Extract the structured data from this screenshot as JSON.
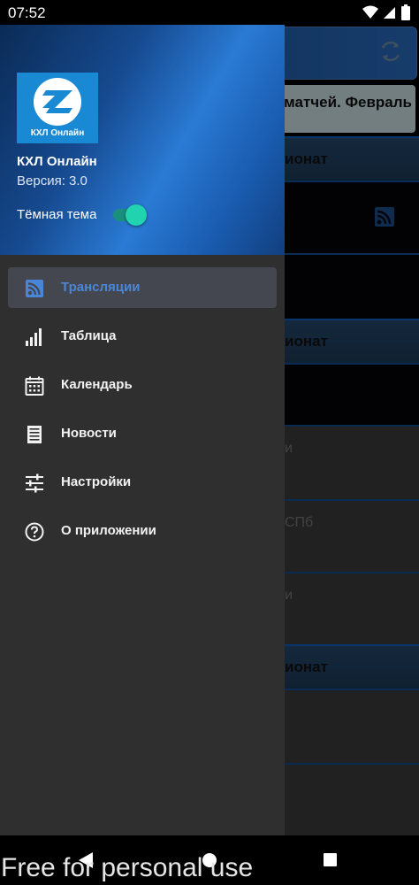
{
  "status_bar": {
    "time": "07:52"
  },
  "background": {
    "banner_text": "матчей. Февраль",
    "sections": [
      "ионат",
      "ионат",
      "ионат"
    ],
    "rows": [
      "и",
      "СПб",
      "и"
    ]
  },
  "drawer": {
    "logo_text": "КХЛ Онлайн",
    "app_name": "КХЛ Онлайн",
    "version": "Версия: 3.0",
    "dark_theme_label": "Тёмная тема",
    "dark_theme_on": true,
    "menu": [
      {
        "label": "Трансляции",
        "icon": "rss-icon",
        "active": true
      },
      {
        "label": "Таблица",
        "icon": "signal-bars-icon",
        "active": false
      },
      {
        "label": "Календарь",
        "icon": "calendar-icon",
        "active": false
      },
      {
        "label": "Новости",
        "icon": "document-icon",
        "active": false
      },
      {
        "label": "Настройки",
        "icon": "sliders-icon",
        "active": false
      },
      {
        "label": "О приложении",
        "icon": "help-circle-icon",
        "active": false
      }
    ]
  },
  "watermark": "Free for personal use",
  "colors": {
    "accent": "#4a86d8",
    "toggle": "#22d3b0",
    "drawer_bg": "#2f2f2f"
  }
}
